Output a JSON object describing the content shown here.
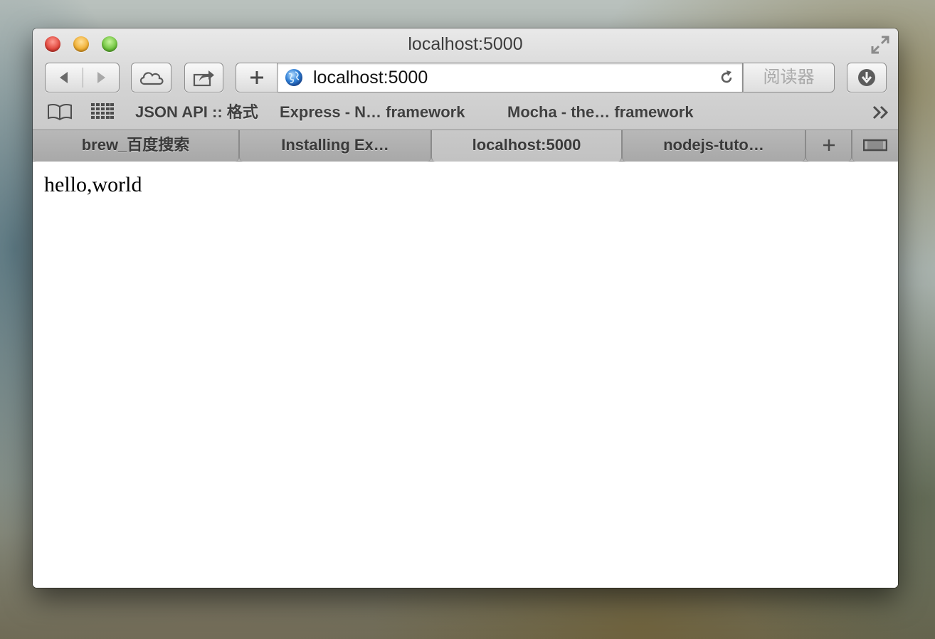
{
  "window": {
    "title": "localhost:5000"
  },
  "toolbar": {
    "address_value": "localhost:5000",
    "reader_label": "阅读器"
  },
  "bookmarks": [
    {
      "label": "JSON API :: 格式"
    },
    {
      "label": "Express - N… framework"
    },
    {
      "label": "Mocha - the… framework"
    }
  ],
  "tabs": [
    {
      "label": "brew_百度搜索",
      "active": false
    },
    {
      "label": "Installing Ex…",
      "active": false
    },
    {
      "label": "localhost:5000",
      "active": true
    },
    {
      "label": "nodejs-tuto…",
      "active": false
    }
  ],
  "page": {
    "body_text": "hello,world"
  }
}
